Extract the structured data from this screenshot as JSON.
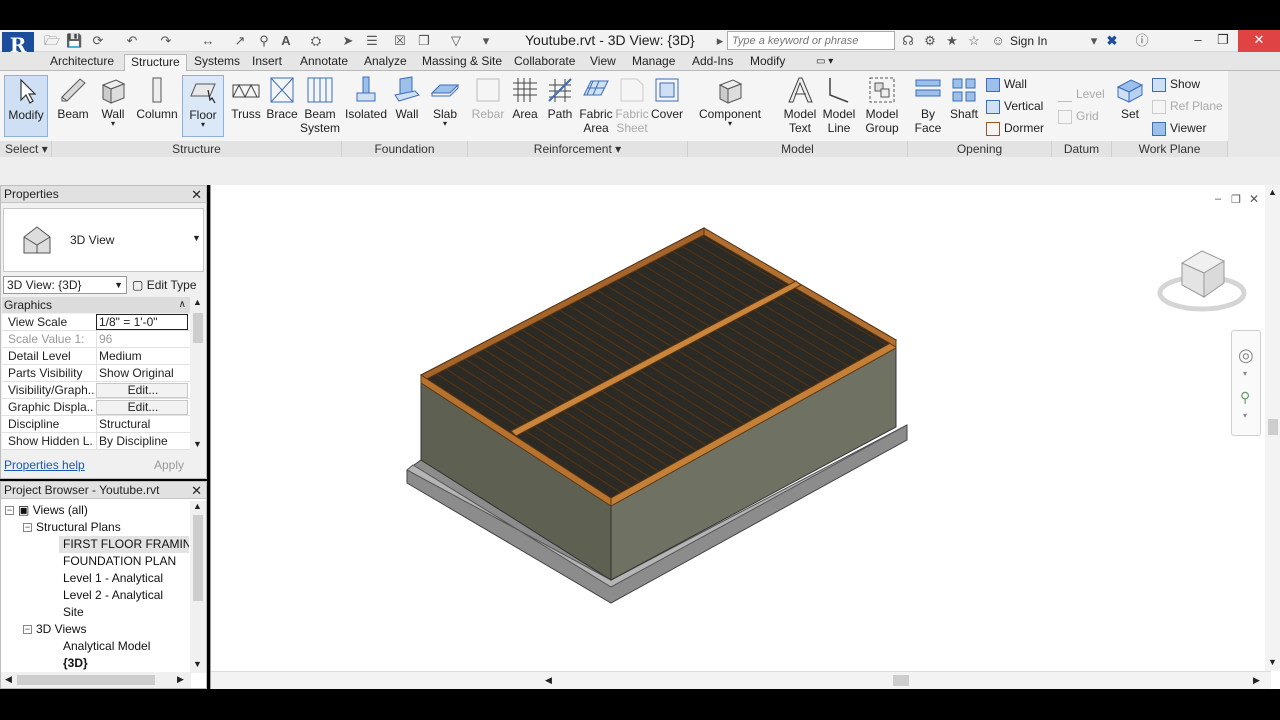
{
  "titlebar": {
    "logo": "R",
    "doc_title": "Youtube.rvt - 3D View: {3D}",
    "search_placeholder": "Type a keyword or phrase",
    "sign_in": "Sign In"
  },
  "tabs": [
    "Architecture",
    "Structure",
    "Systems",
    "Insert",
    "Annotate",
    "Analyze",
    "Massing & Site",
    "Collaborate",
    "View",
    "Manage",
    "Add-Ins",
    "Modify"
  ],
  "active_tab": "Structure",
  "ribbon": {
    "modify": "Modify",
    "select_panel": "Select",
    "structure": {
      "panel": "Structure",
      "beam": "Beam",
      "wall": "Wall",
      "column": "Column",
      "floor": "Floor",
      "truss": "Truss",
      "brace": "Brace",
      "beam_system_1": "Beam",
      "beam_system_2": "System"
    },
    "foundation": {
      "panel": "Foundation",
      "isolated": "Isolated",
      "wall": "Wall",
      "slab": "Slab"
    },
    "reinforcement": {
      "panel": "Reinforcement",
      "rebar": "Rebar",
      "area": "Area",
      "path": "Path",
      "fabric_area_1": "Fabric",
      "fabric_area_2": "Area",
      "fabric_sheet_1": "Fabric",
      "fabric_sheet_2": "Sheet",
      "cover": "Cover"
    },
    "model": {
      "panel": "Model",
      "component": "Component",
      "model_text_1": "Model",
      "model_text_2": "Text",
      "model_line_1": "Model",
      "model_line_2": "Line",
      "model_group_1": "Model",
      "model_group_2": "Group"
    },
    "opening": {
      "panel": "Opening",
      "by_face_1": "By",
      "by_face_2": "Face",
      "shaft": "Shaft",
      "wall": "Wall",
      "vertical": "Vertical",
      "dormer": "Dormer"
    },
    "datum": {
      "panel": "Datum",
      "level": "Level",
      "grid": "Grid"
    },
    "work_plane": {
      "panel": "Work Plane",
      "set": "Set",
      "show": "Show",
      "ref_plane": "Ref Plane",
      "viewer": "Viewer"
    }
  },
  "properties": {
    "title": "Properties",
    "type_name": "3D View",
    "view_select": "3D View: {3D}",
    "edit_type": "Edit Type",
    "section": "Graphics",
    "rows": [
      {
        "k": "View Scale",
        "v": "1/8\" = 1'-0\""
      },
      {
        "k": "Scale Value    1:",
        "v": "96"
      },
      {
        "k": "Detail Level",
        "v": "Medium"
      },
      {
        "k": "Parts Visibility",
        "v": "Show Original"
      },
      {
        "k": "Visibility/Graph...",
        "v": "Edit..."
      },
      {
        "k": "Graphic Displa...",
        "v": "Edit..."
      },
      {
        "k": "Discipline",
        "v": "Structural"
      },
      {
        "k": "Show Hidden L...",
        "v": "By Discipline"
      }
    ],
    "help": "Properties help",
    "apply": "Apply"
  },
  "browser": {
    "title": "Project Browser - Youtube.rvt",
    "items": [
      "Views (all)",
      "Structural Plans",
      "FIRST FLOOR FRAMING P",
      "FOUNDATION PLAN",
      "Level 1 - Analytical",
      "Level 2 - Analytical",
      "Site",
      "3D Views",
      "Analytical Model",
      "{3D}"
    ]
  },
  "colors": {
    "accent": "#1b4d9c",
    "wood": "#b7732e",
    "wall": "#5c5f52",
    "slab": "#9a9a9a"
  }
}
